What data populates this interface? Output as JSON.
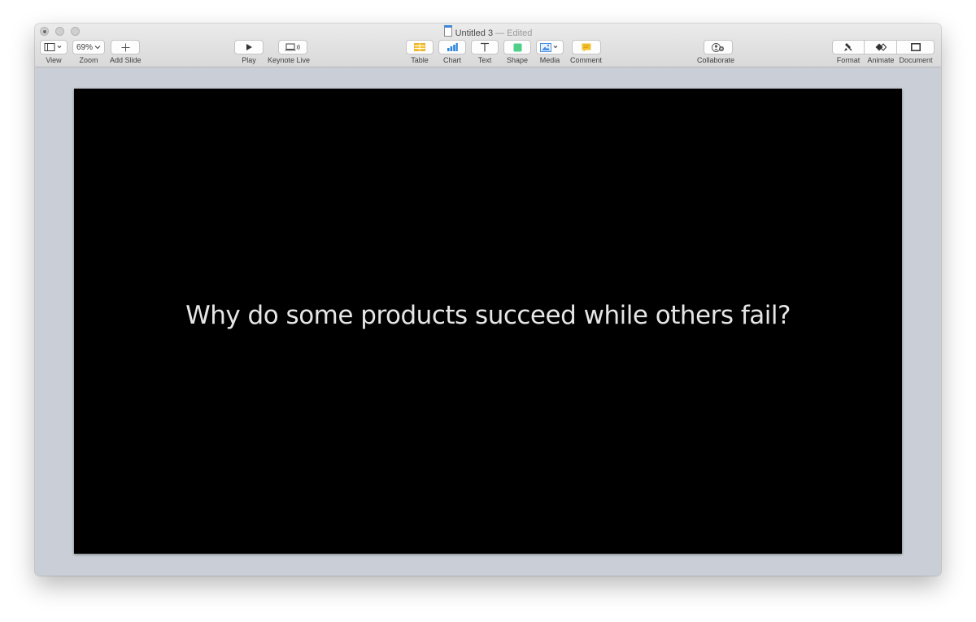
{
  "window": {
    "title": "Untitled 3",
    "edited": "— Edited"
  },
  "toolbar": {
    "view": {
      "label": "View",
      "icon": "sidebar-icon"
    },
    "zoom": {
      "label": "Zoom",
      "value": "69%"
    },
    "add_slide": {
      "label": "Add Slide",
      "icon": "plus-icon"
    },
    "play": {
      "label": "Play",
      "icon": "play-icon"
    },
    "keynote_live": {
      "label": "Keynote Live",
      "icon": "keynote-live-icon"
    },
    "table": {
      "label": "Table",
      "icon": "table-icon",
      "color": "#f5c12e"
    },
    "chart": {
      "label": "Chart",
      "icon": "chart-icon",
      "color": "#2f86dd"
    },
    "text": {
      "label": "Text",
      "icon": "text-icon"
    },
    "shape": {
      "label": "Shape",
      "icon": "shape-icon",
      "color": "#4fcf8a"
    },
    "media": {
      "label": "Media",
      "icon": "media-icon",
      "color": "#4a90e2"
    },
    "comment": {
      "label": "Comment",
      "icon": "comment-icon",
      "color": "#f5c12e"
    },
    "collaborate": {
      "label": "Collaborate",
      "icon": "collaborate-icon"
    },
    "format": {
      "label": "Format",
      "icon": "paintbrush-icon"
    },
    "animate": {
      "label": "Animate",
      "icon": "animate-icon"
    },
    "document": {
      "label": "Document",
      "icon": "document-icon"
    }
  },
  "slide": {
    "text": "Why do some products succeed while others fail?",
    "background": "#000000"
  }
}
